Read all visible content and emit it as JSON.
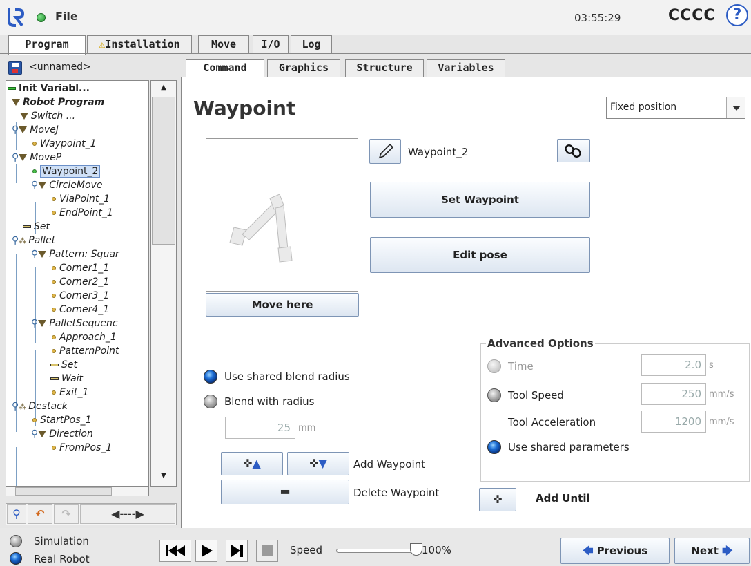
{
  "header": {
    "file_label": "File",
    "clock": "03:55:29",
    "robot_name": "CCCC",
    "help_symbol": "?"
  },
  "main_tabs": [
    {
      "label": "Program",
      "active": true
    },
    {
      "label": "Installation",
      "warning": true
    },
    {
      "label": "Move"
    },
    {
      "label": "I/O"
    },
    {
      "label": "Log"
    }
  ],
  "program": {
    "name": "<unnamed>"
  },
  "tree": [
    {
      "label": "Init Variabl...",
      "bold": true
    },
    {
      "label": "Robot Program",
      "bold": true,
      "italic": true
    },
    {
      "label": "Switch ..."
    },
    {
      "label": "MoveJ"
    },
    {
      "label": "Waypoint_1"
    },
    {
      "label": "MoveP"
    },
    {
      "label": "Waypoint_2",
      "selected": true
    },
    {
      "label": "CircleMove"
    },
    {
      "label": "ViaPoint_1"
    },
    {
      "label": "EndPoint_1"
    },
    {
      "label": "Set"
    },
    {
      "label": "Pallet"
    },
    {
      "label": "Pattern: Squar"
    },
    {
      "label": "Corner1_1"
    },
    {
      "label": "Corner2_1"
    },
    {
      "label": "Corner3_1"
    },
    {
      "label": "Corner4_1"
    },
    {
      "label": "PalletSequenc"
    },
    {
      "label": "Approach_1"
    },
    {
      "label": "PatternPoint"
    },
    {
      "label": "Set"
    },
    {
      "label": "Wait"
    },
    {
      "label": "Exit_1"
    },
    {
      "label": "Destack"
    },
    {
      "label": "StartPos_1"
    },
    {
      "label": "Direction"
    },
    {
      "label": "FromPos_1"
    }
  ],
  "command_tabs": [
    {
      "label": "Command",
      "active": true
    },
    {
      "label": "Graphics"
    },
    {
      "label": "Structure"
    },
    {
      "label": "Variables"
    }
  ],
  "waypoint": {
    "title": "Waypoint",
    "position_mode": "Fixed position",
    "name": "Waypoint_2",
    "set_waypoint": "Set Waypoint",
    "edit_pose": "Edit pose",
    "move_here": "Move here",
    "use_shared_blend": "Use shared blend radius",
    "blend_with_radius": "Blend with radius",
    "blend_value": "25",
    "blend_unit": "mm",
    "add_waypoint": "Add Waypoint",
    "delete_waypoint": "Delete Waypoint",
    "add_until": "Add Until"
  },
  "advanced": {
    "title": "Advanced Options",
    "time_label": "Time",
    "time_value": "2.0",
    "time_unit": "s",
    "tool_speed_label": "Tool Speed",
    "tool_speed_value": "250",
    "tool_speed_unit": "mm/s",
    "tool_accel_label": "Tool Acceleration",
    "tool_accel_value": "1200",
    "tool_accel_unit": "mm/s",
    "shared_params_label": "Use shared parameters"
  },
  "footer": {
    "simulation": "Simulation",
    "real_robot": "Real Robot",
    "speed_label": "Speed",
    "speed_value": "100%",
    "speed_fraction": 1.0,
    "previous": "Previous",
    "next": "Next"
  },
  "colors": {
    "accent_blue": "#2c5cc4",
    "status_green": "#1f8f2c",
    "warning_yellow": "#f2c200"
  }
}
